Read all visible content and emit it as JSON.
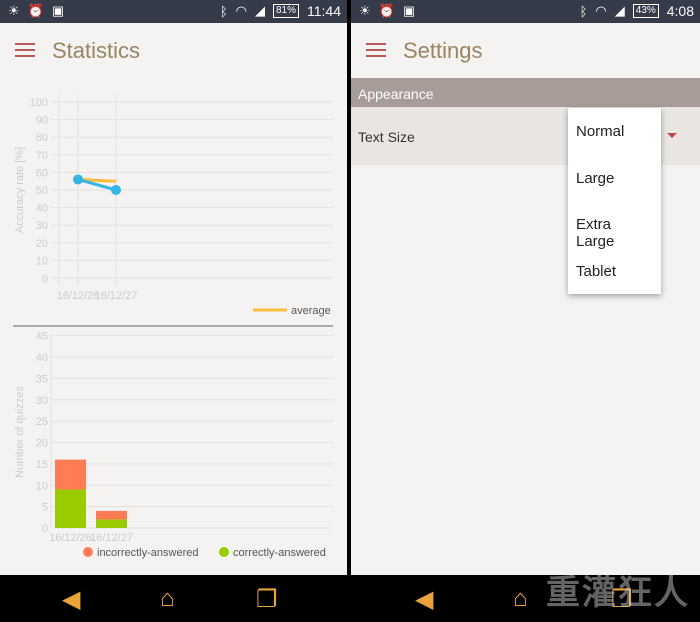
{
  "left": {
    "status": {
      "battery": "81%",
      "time": "11:44"
    },
    "title": "Statistics",
    "nav": {
      "back": "back-icon",
      "home": "home-icon",
      "recents": "recents-icon"
    }
  },
  "right": {
    "status": {
      "battery": "43%",
      "time": "4:08"
    },
    "title": "Settings",
    "section": "Appearance",
    "text_size_label": "Text Size",
    "options": [
      "Normal",
      "Large",
      "Extra Large",
      "Tablet"
    ],
    "watermark": "重灌狂人 HTTP://BRIAN.COM"
  },
  "colors": {
    "accent": "#b65a5e",
    "title": "#9a8462",
    "status_bar": "#363b4a",
    "line": "#35b5e5",
    "average": "#fcbc3c",
    "incorrect": "#ff7c55",
    "correct": "#99cc00"
  },
  "chart_data": [
    {
      "type": "line",
      "ylabel": "Accuracy rate [%]",
      "categories": [
        "16/12/26",
        "16/12/27"
      ],
      "ylim": [
        0,
        100
      ],
      "yticks": [
        0,
        10,
        20,
        30,
        40,
        50,
        60,
        70,
        80,
        90,
        100
      ],
      "grid": true,
      "series": [
        {
          "values": [
            56,
            50
          ],
          "color": "#35b5e5"
        },
        {
          "name": "average",
          "values": [
            56,
            55
          ],
          "color": "#fcbc3c"
        }
      ],
      "legend": "bottom-right"
    },
    {
      "type": "bar",
      "stacked": true,
      "ylabel": "Number of quizzes",
      "categories": [
        "16/12/26",
        "16/12/27"
      ],
      "ylim": [
        0,
        45
      ],
      "yticks": [
        0,
        5,
        10,
        15,
        20,
        25,
        30,
        35,
        40,
        45
      ],
      "grid": true,
      "series": [
        {
          "name": "correctly-answered",
          "values": [
            9,
            2
          ],
          "color": "#99cc00"
        },
        {
          "name": "incorrectly-answered",
          "values": [
            7,
            2
          ],
          "color": "#ff7c55"
        }
      ],
      "legend": "bottom-right"
    }
  ]
}
